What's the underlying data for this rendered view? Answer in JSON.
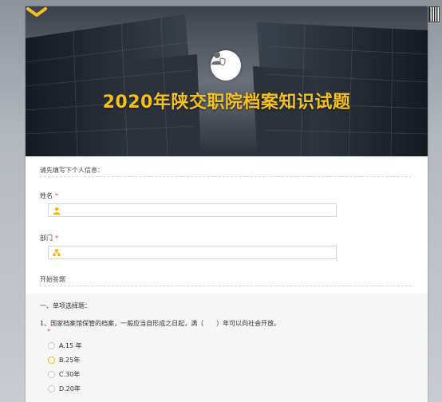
{
  "survey": {
    "title": "2020年陕交职院档案知识试题"
  },
  "intro": {
    "info_prompt": "请先填写下个人信息："
  },
  "fields": {
    "name": {
      "label": "姓名",
      "required_mark": "*",
      "value": ""
    },
    "department": {
      "label": "部门",
      "required_mark": "*",
      "value": ""
    }
  },
  "start_label": "开始答题",
  "section": {
    "heading": "一、单项选择题："
  },
  "question1": {
    "text": "1、国家档案馆保管的档案，一般应当自形成之日起，满（　　）年可以向社会开放。",
    "required_mark": "*",
    "options": [
      "A.15 年",
      "B.25年",
      "C.30年",
      "D.20年"
    ]
  },
  "colors": {
    "accent": "#f4c21b",
    "required": "#ee3333",
    "radio_hover": "#f0b400"
  },
  "icons": {
    "avatar": "user-shield-icon",
    "chevron": "chevron-down-icon",
    "name_field": "person-icon",
    "department_field": "org-icon",
    "qr": "qr-code-icon"
  }
}
